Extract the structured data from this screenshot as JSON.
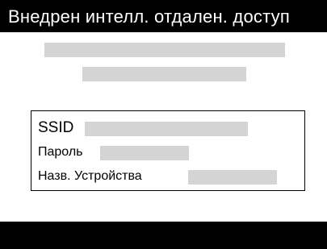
{
  "header": {
    "title": "Внедрен интелл. отдален. доступ"
  },
  "info_box": {
    "ssid_label": "SSID",
    "password_label": "Пароль",
    "device_name_label": "Назв. Устройства"
  },
  "colors": {
    "title_bar_background": "#000000",
    "title_text": "#ffffff",
    "placeholder_bar": "#d4d4d4",
    "background": "#ffffff"
  }
}
